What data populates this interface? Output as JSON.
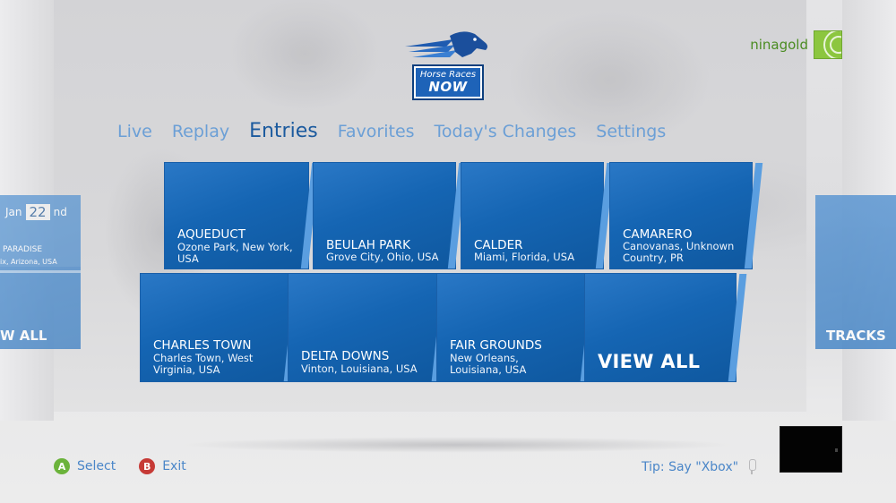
{
  "app": {
    "logo": {
      "line1": "Horse Races",
      "line2": "NOW"
    }
  },
  "user": {
    "name": "ninagold"
  },
  "nav": {
    "items": [
      {
        "label": "Live"
      },
      {
        "label": "Replay"
      },
      {
        "label": "Entries",
        "active": true
      },
      {
        "label": "Favorites"
      },
      {
        "label": "Today's Changes"
      },
      {
        "label": "Settings"
      }
    ]
  },
  "left_panel": {
    "month": "Jan",
    "day": "22",
    "suffix": "nd",
    "track_name": "PARADISE",
    "track_location": "ix, Arizona, USA",
    "view_all": "W ALL"
  },
  "right_panel": {
    "label": "TRACKS"
  },
  "tracks": [
    {
      "name": "AQUEDUCT",
      "location": "Ozone Park, New York, USA"
    },
    {
      "name": "BEULAH PARK",
      "location": "Grove City, Ohio, USA"
    },
    {
      "name": "CALDER",
      "location": "Miami, Florida, USA"
    },
    {
      "name": "CAMARERO",
      "location": "Canovanas, Unknown Country, PR"
    },
    {
      "name": "CHARLES TOWN",
      "location": "Charles Town, West Virginia, USA"
    },
    {
      "name": "DELTA DOWNS",
      "location": "Vinton, Louisiana, USA"
    },
    {
      "name": "FAIR GROUNDS",
      "location": "New Orleans, Louisiana, USA"
    }
  ],
  "view_all_tile": {
    "label": "VIEW ALL"
  },
  "bottom_bar": {
    "select_button": "A",
    "select_label": "Select",
    "exit_button": "B",
    "exit_label": "Exit",
    "tip": "Tip: Say \"Xbox\""
  },
  "colors": {
    "tile_blue": "#1565b3",
    "nav_active": "#1b5a9e",
    "nav_inactive": "#6b9fd6",
    "user_green": "#4b8c22",
    "a_button": "#6bb33b",
    "b_button": "#c63a36"
  },
  "icons": {
    "logo": "horse-head-icon",
    "avatar": "gamerpic-icon",
    "mic": "microphone-icon"
  }
}
